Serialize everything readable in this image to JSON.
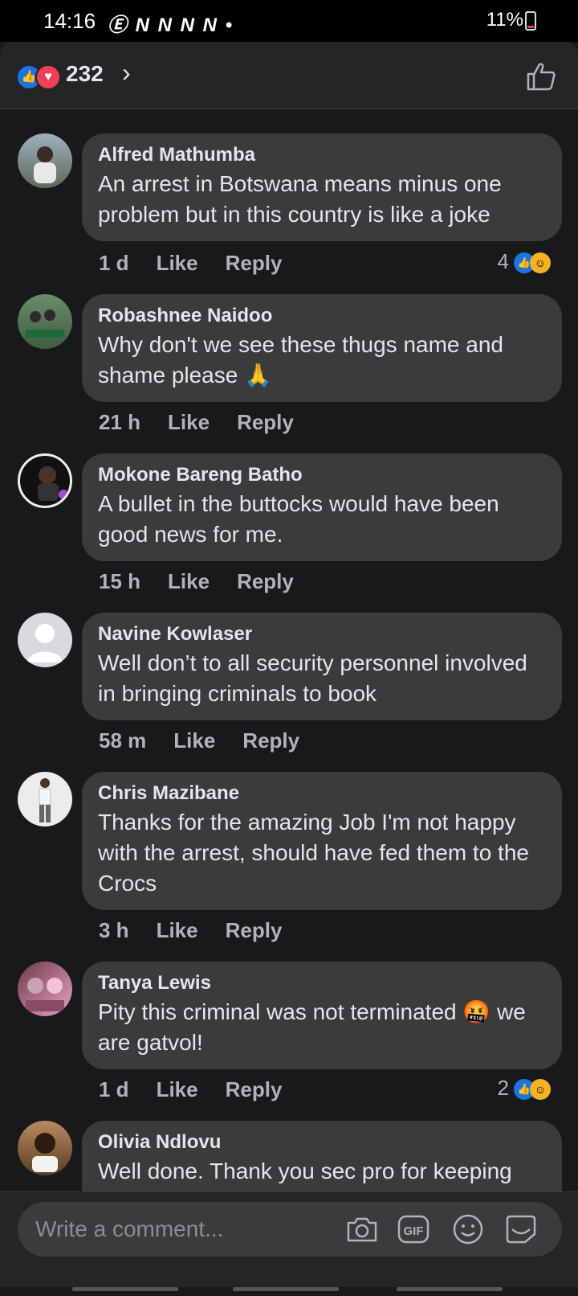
{
  "status_bar": {
    "time": "14:16",
    "icons": "Ⓔ N N N N •",
    "battery": "11%"
  },
  "header": {
    "reaction_count": "232",
    "chevron": "›"
  },
  "comments": [
    {
      "name": "Alfred Mathumba",
      "text": "An arrest in Botswana means minus one problem but in this country is like a joke",
      "time": "1 d",
      "like": "Like",
      "reply": "Reply",
      "reactions": "4"
    },
    {
      "name": "Robashnee Naidoo",
      "text": "Why don't we see these thugs name and shame please 🙏",
      "time": "21 h",
      "like": "Like",
      "reply": "Reply"
    },
    {
      "name": "Mokone Bareng Batho",
      "text": "A bullet in the buttocks would have been good news for me.",
      "time": "15 h",
      "like": "Like",
      "reply": "Reply"
    },
    {
      "name": "Navine Kowlaser",
      "text": "Well don’t to all security personnel involved in bringing criminals to book",
      "time": "58 m",
      "like": "Like",
      "reply": "Reply"
    },
    {
      "name": "Chris Mazibane",
      "text": "Thanks for the amazing Job I'm not happy with the arrest, should have fed them to the Crocs",
      "time": "3 h",
      "like": "Like",
      "reply": "Reply"
    },
    {
      "name": "Tanya Lewis",
      "text": "Pity this criminal was not terminated 🤬 we are gatvol!",
      "time": "1 d",
      "like": "Like",
      "reply": "Reply",
      "reactions": "2"
    },
    {
      "name": "Olivia Ndlovu",
      "text": "Well done. Thank you sec pro for keeping",
      "time": "",
      "like": "",
      "reply": ""
    }
  ],
  "composer": {
    "placeholder": "Write a comment..."
  },
  "colors": {
    "background": "#18191a",
    "bubble": "#3a3b3c",
    "accent": "#1b74e4"
  },
  "icons": [
    "like-reaction-icon",
    "love-reaction-icon",
    "chevron-right-icon",
    "thumbs-up-icon",
    "camera-icon",
    "gif-icon",
    "emoji-icon",
    "sticker-icon"
  ]
}
